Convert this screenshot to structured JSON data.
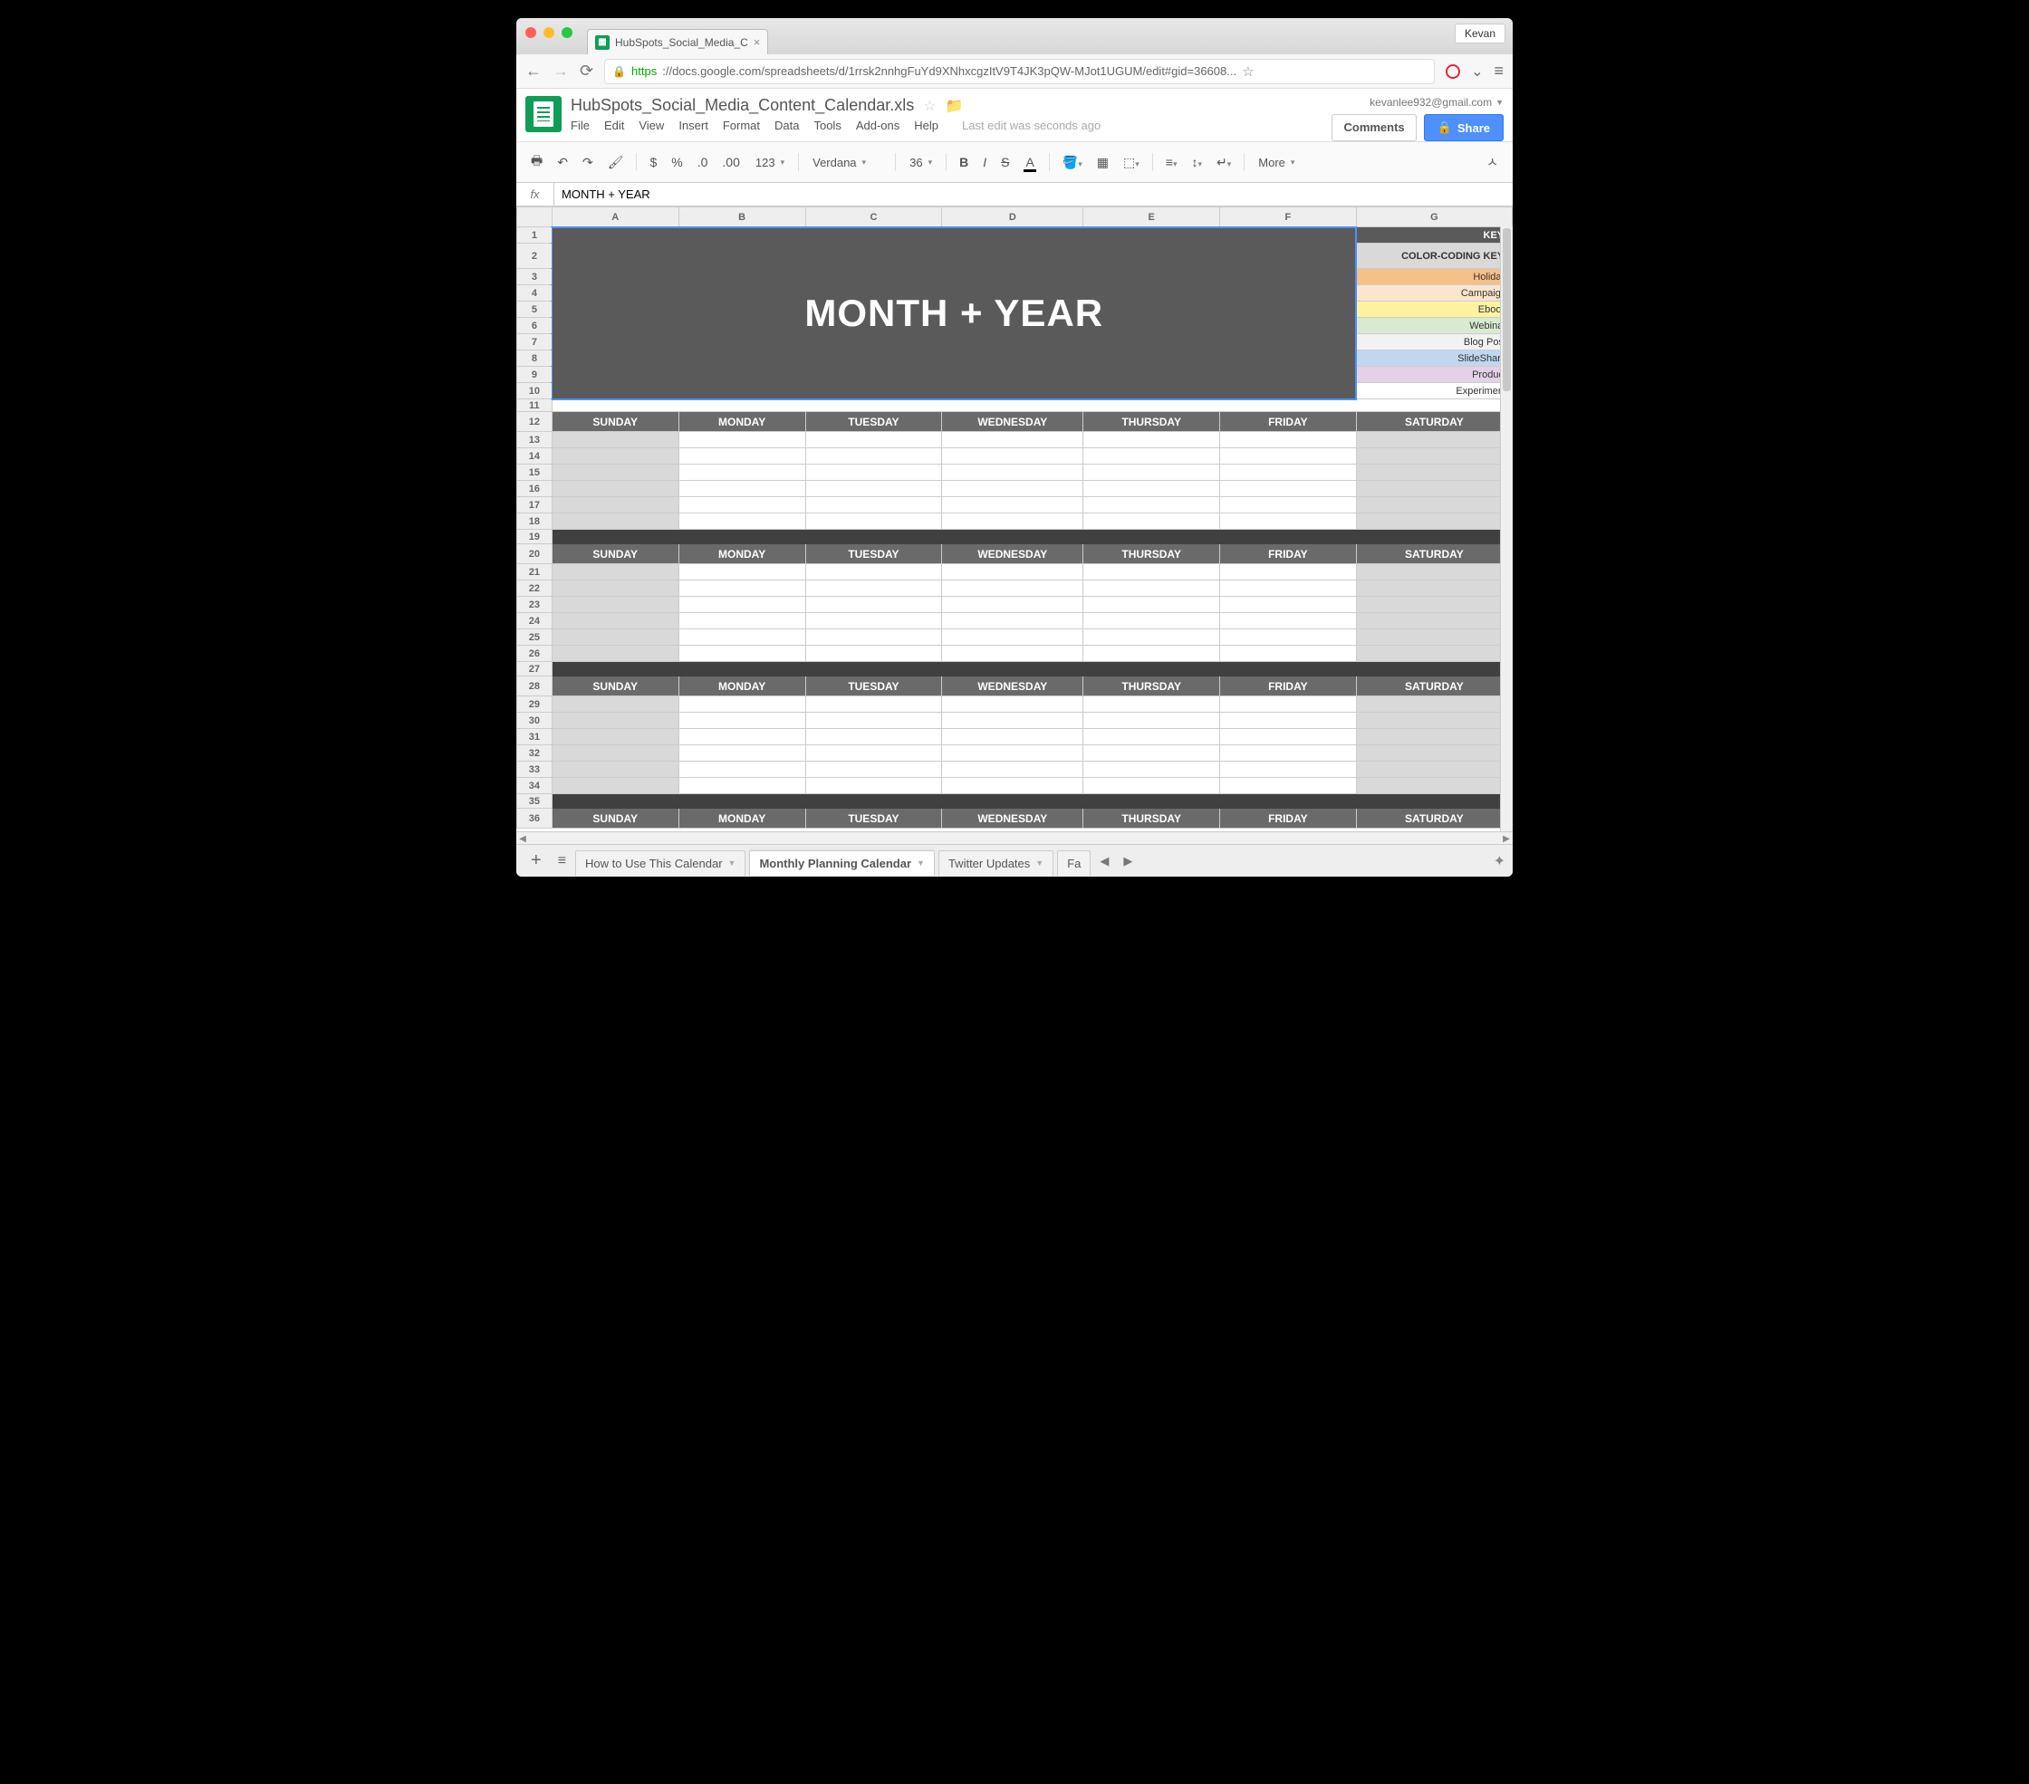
{
  "browser": {
    "profile": "Kevan",
    "tab_title": "HubSpots_Social_Media_C",
    "url_proto": "https",
    "url_host": "://docs.google.com",
    "url_path": "/spreadsheets/d/1rrsk2nnhgFuYd9XNhxcgzItV9T4JK3pQW-MJot1UGUM/edit#gid=36608..."
  },
  "sheets": {
    "doc_title": "HubSpots_Social_Media_Content_Calendar.xls",
    "user_email": "kevanlee932@gmail.com",
    "menu": {
      "file": "File",
      "edit": "Edit",
      "view": "View",
      "insert": "Insert",
      "format": "Format",
      "data": "Data",
      "tools": "Tools",
      "addons": "Add-ons",
      "help": "Help"
    },
    "status": "Last edit was seconds ago",
    "comments_btn": "Comments",
    "share_btn": "Share"
  },
  "toolbar": {
    "currency": "$",
    "percent": "%",
    "dec_dec": ".0",
    "dec_inc": ".00",
    "num_format": "123",
    "font": "Verdana",
    "font_size": "36",
    "more": "More"
  },
  "formula_bar": {
    "value": "MONTH + YEAR"
  },
  "columns": [
    "A",
    "B",
    "C",
    "D",
    "E",
    "F",
    "G"
  ],
  "banner_text": "MONTH + YEAR",
  "key": {
    "header1": "KEY:",
    "header2": "COLOR-CODING KEY:",
    "rows": [
      {
        "label": "Holiday",
        "color": "#f6c089"
      },
      {
        "label": "Campaign",
        "color": "#fbe5cd"
      },
      {
        "label": "Ebook",
        "color": "#fff3a1"
      },
      {
        "label": "Webinar",
        "color": "#d9ead3"
      },
      {
        "label": "Blog Post",
        "color": "#f2f2f2"
      },
      {
        "label": "SlideShare",
        "color": "#c0d7ef"
      },
      {
        "label": "Product",
        "color": "#e3d1e7"
      },
      {
        "label": "Experiment",
        "color": "#ffffff"
      }
    ]
  },
  "days": [
    "SUNDAY",
    "MONDAY",
    "TUESDAY",
    "WEDNESDAY",
    "THURSDAY",
    "FRIDAY",
    "SATURDAY"
  ],
  "sheet_tabs": {
    "t0": "How to Use This Calendar",
    "t1": "Monthly Planning Calendar",
    "t2": "Twitter Updates",
    "t3": "Fa"
  }
}
